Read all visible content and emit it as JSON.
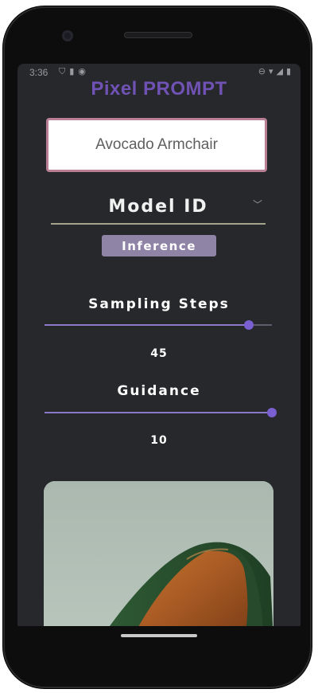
{
  "status_bar": {
    "time": "3:36",
    "left_icons": [
      "shield-icon",
      "sim-icon",
      "notification-icon"
    ],
    "right_icons": [
      "minus-circle-icon",
      "wifi-icon",
      "signal-icon",
      "battery-icon"
    ]
  },
  "app": {
    "title": "Pixel PROMPT"
  },
  "prompt": {
    "value": "Avocado Armchair"
  },
  "model": {
    "label": "Model ID"
  },
  "inference": {
    "label": "Inference"
  },
  "sampling": {
    "title": "Sampling Steps",
    "value": "45",
    "fraction": 0.9
  },
  "guidance": {
    "title": "Guidance",
    "value": "10",
    "fraction": 1.0
  },
  "colors": {
    "accent": "#6f52b4",
    "background": "#26282b",
    "button": "#8f83a6",
    "prompt_border": "#b87f95"
  }
}
